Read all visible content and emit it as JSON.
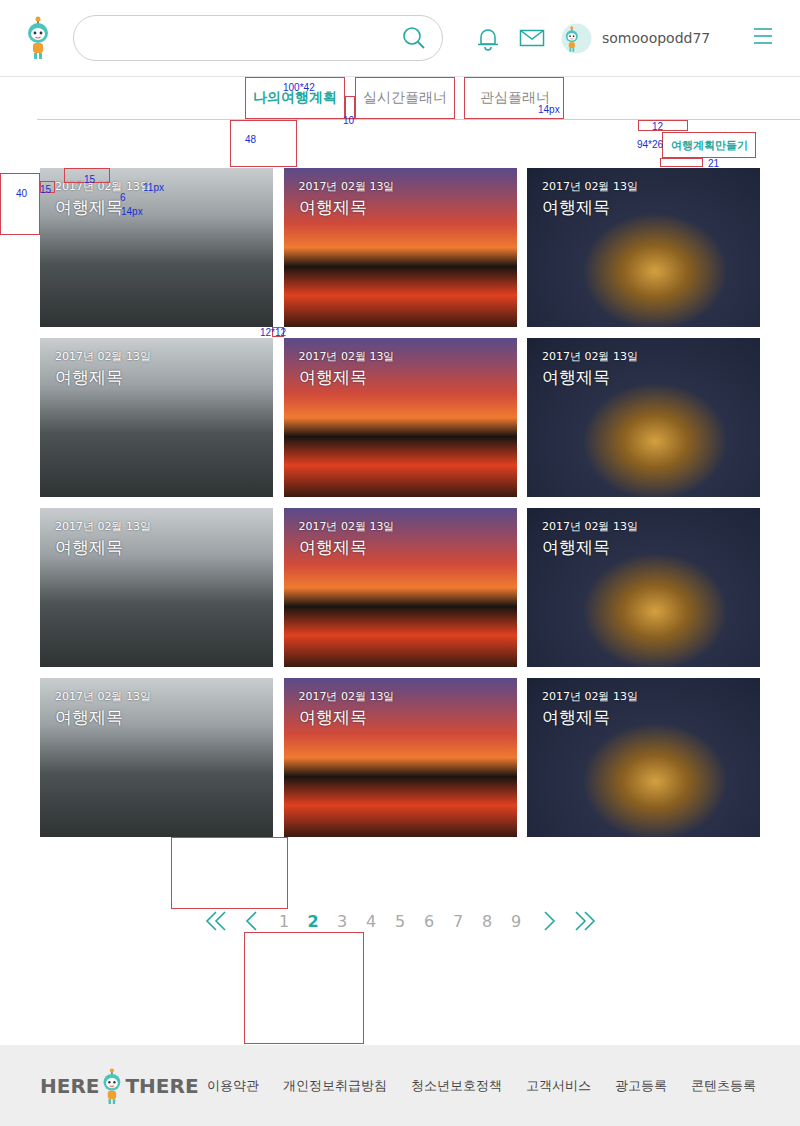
{
  "header": {
    "username": "somooopodd77"
  },
  "tabs": [
    {
      "label": "나의여행계획",
      "selected": true
    },
    {
      "label": "실시간플래너",
      "selected": false
    },
    {
      "label": "관심플래너",
      "selected": false
    }
  ],
  "create_button": "여행계획만들기",
  "trips": [
    {
      "date": "2017년 02월 13일",
      "title": "여행제목"
    },
    {
      "date": "2017년 02월 13일",
      "title": "여행제목"
    },
    {
      "date": "2017년 02월 13일",
      "title": "여행제목"
    },
    {
      "date": "2017년 02월 13일",
      "title": "여행제목"
    },
    {
      "date": "2017년 02월 13일",
      "title": "여행제목"
    },
    {
      "date": "2017년 02월 13일",
      "title": "여행제목"
    },
    {
      "date": "2017년 02월 13일",
      "title": "여행제목"
    },
    {
      "date": "2017년 02월 13일",
      "title": "여행제목"
    },
    {
      "date": "2017년 02월 13일",
      "title": "여행제목"
    },
    {
      "date": "2017년 02월 13일",
      "title": "여행제목"
    },
    {
      "date": "2017년 02월 13일",
      "title": "여행제목"
    },
    {
      "date": "2017년 02월 13일",
      "title": "여행제목"
    }
  ],
  "pagination": {
    "pages": [
      {
        "label": "1",
        "selected": false
      },
      {
        "label": "2",
        "selected": true
      },
      {
        "label": "3",
        "selected": false
      },
      {
        "label": "4",
        "selected": false
      },
      {
        "label": "5",
        "selected": false
      },
      {
        "label": "6",
        "selected": false
      },
      {
        "label": "7",
        "selected": false
      },
      {
        "label": "8",
        "selected": false
      },
      {
        "label": "9",
        "selected": false
      }
    ]
  },
  "footer": {
    "logo_left": "HERE",
    "logo_right": "THERE",
    "links": [
      "이용약관",
      "개인정보취급방침",
      "청소년보호정책",
      "고객서비스",
      "광고등록",
      "콘텐츠등록"
    ]
  },
  "annotations": [
    "100*42",
    "10",
    "14px",
    "48",
    "12",
    "94*26",
    "21",
    "40",
    "15",
    "15",
    "11px",
    "6",
    "14px",
    "12*12"
  ]
}
